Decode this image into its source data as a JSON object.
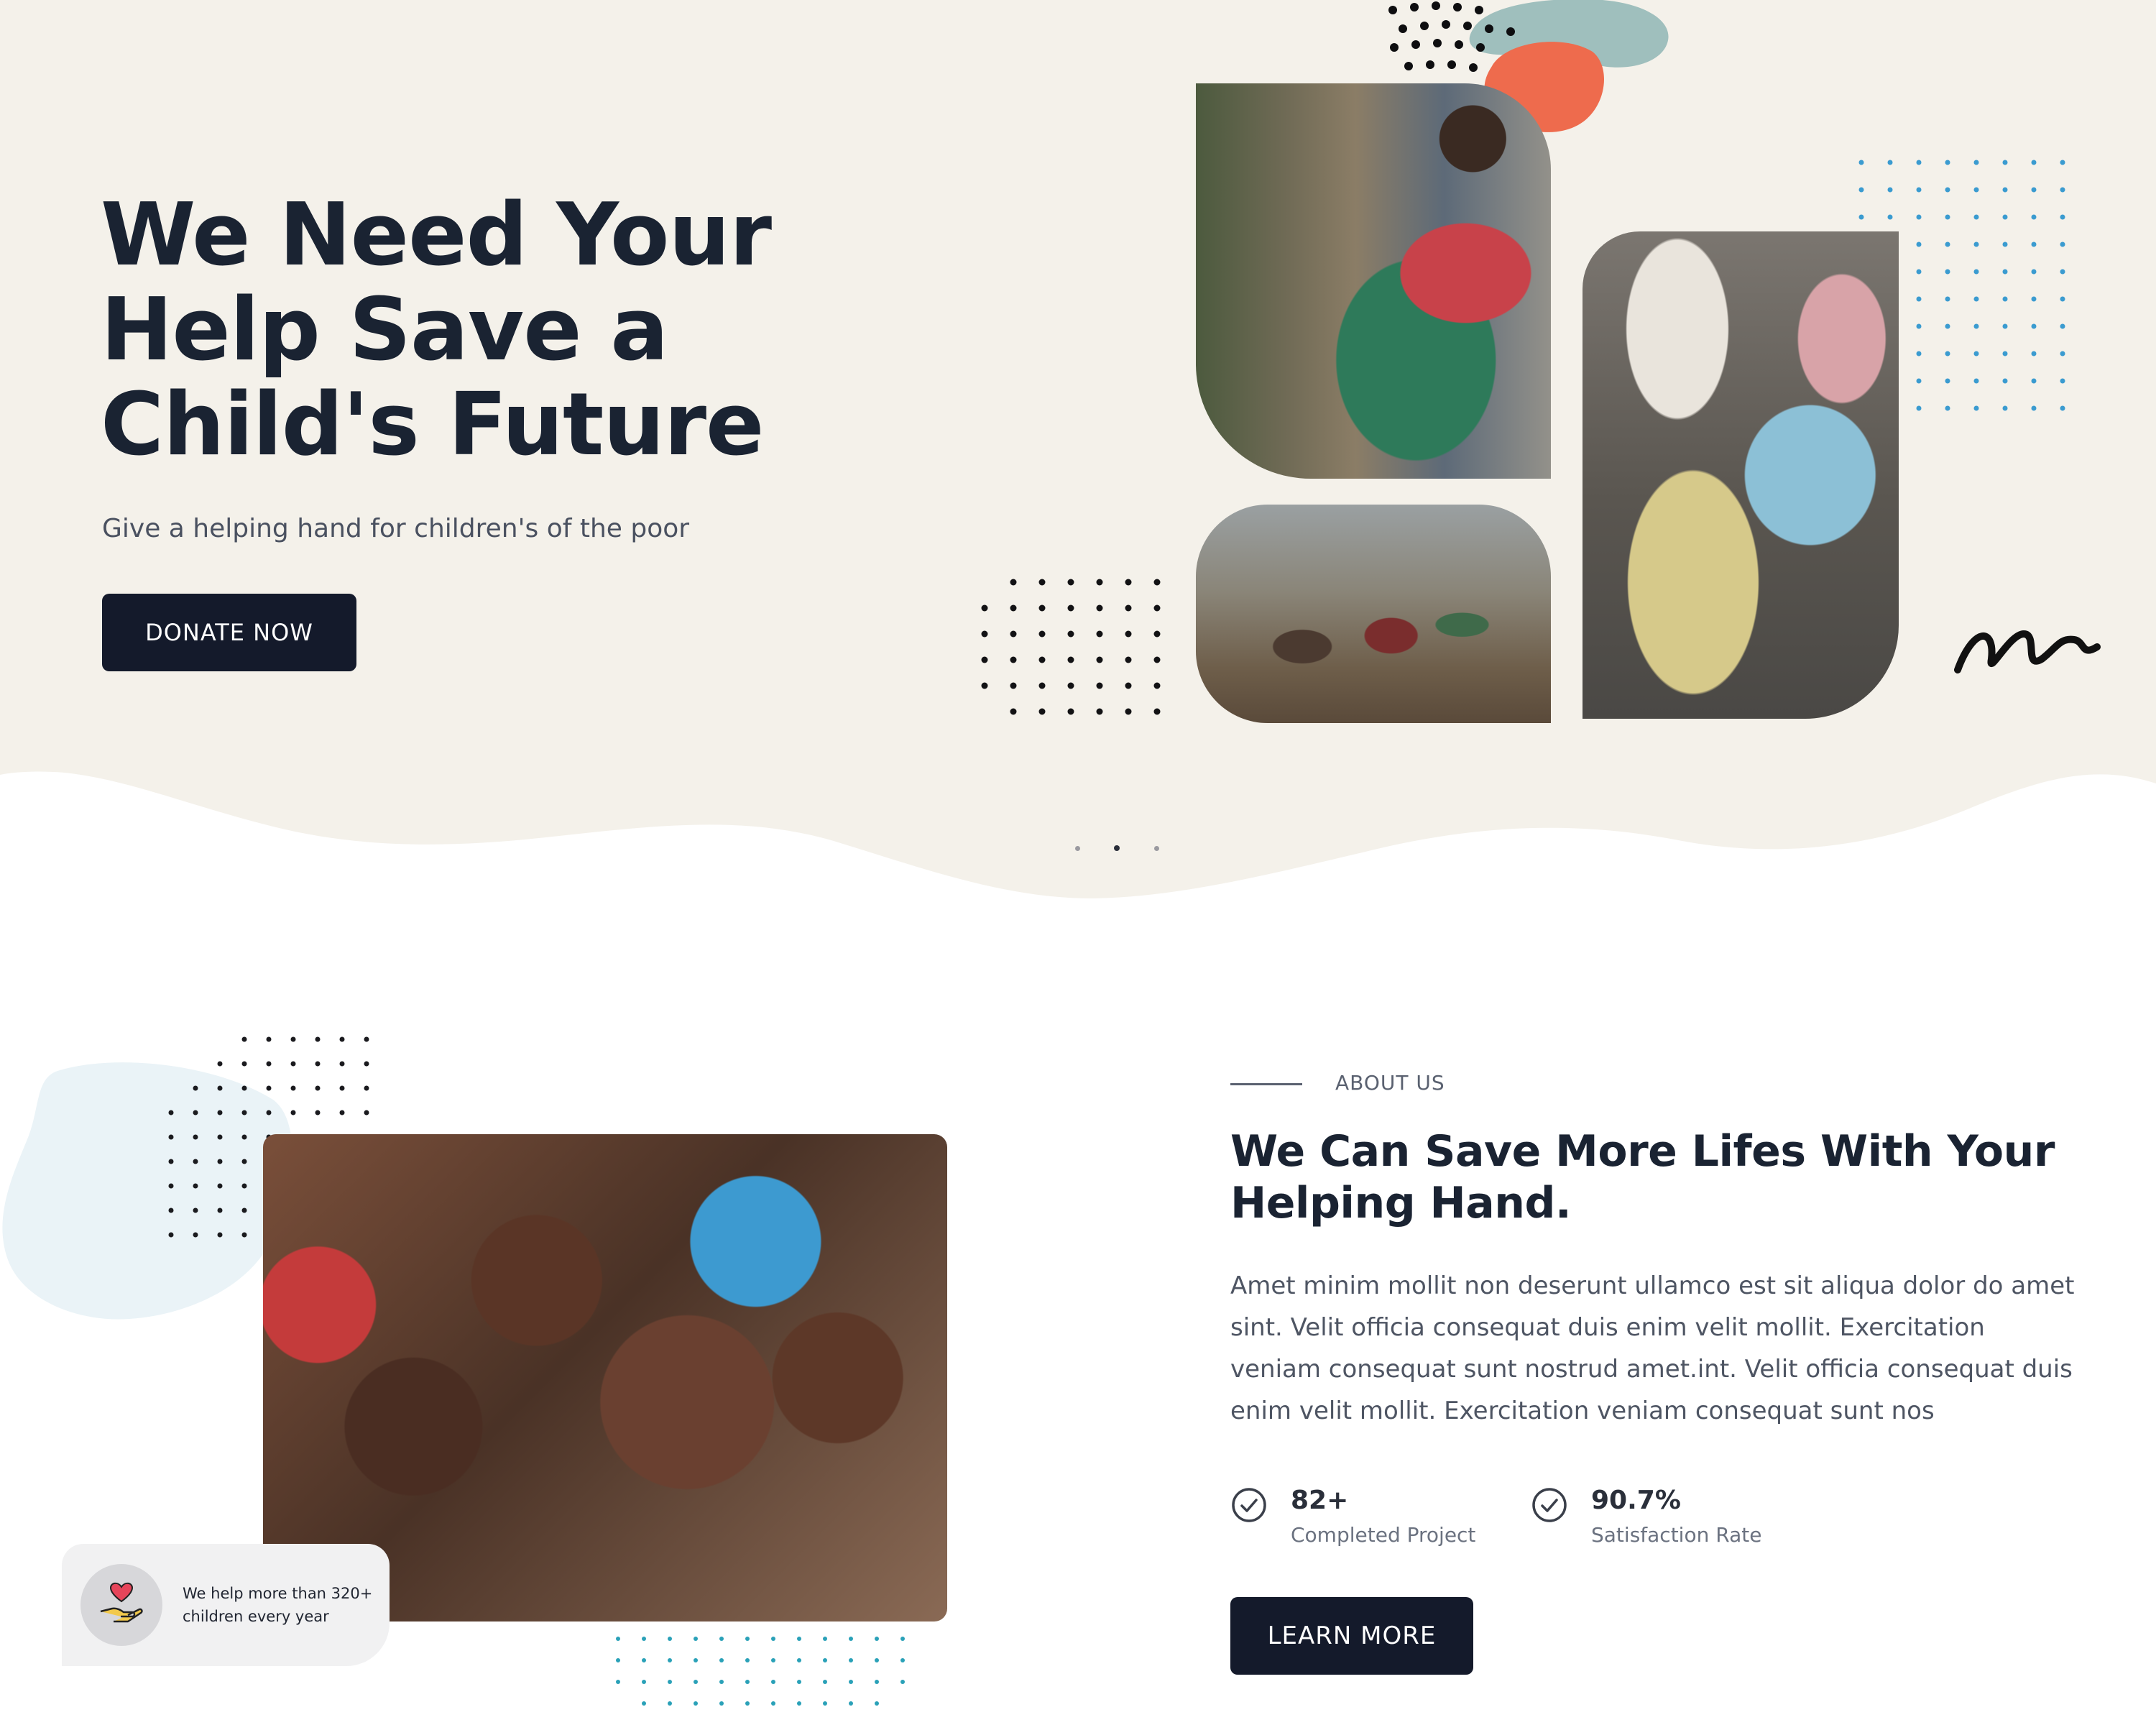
{
  "hero": {
    "title": "We Need Your Help Save a Child's Future",
    "subtitle": "Give a helping hand for children's of the poor",
    "donate_label": "DONATE NOW"
  },
  "about": {
    "section_label": "ABOUT US",
    "title": "We Can Save More Lifes With Your Helping Hand.",
    "body": "Amet minim mollit non deserunt ullamco est sit aliqua dolor do amet sint. Velit officia consequat duis enim velit mollit. Exercitation veniam consequat sunt nostrud amet.int. Velit officia consequat duis enim velit mollit. Exercitation veniam consequat sunt nos",
    "stats": [
      {
        "value": "82+",
        "label": "Completed Project",
        "icon": "check-circle-icon"
      },
      {
        "value": "90.7%",
        "label": "Satisfaction Rate",
        "icon": "check-circle-icon"
      }
    ],
    "learn_more_label": "LEARN MORE"
  },
  "badge": {
    "text": "We help more than 320+ children every year",
    "icon": "heart-hand-icon"
  },
  "slider": {
    "count": 3,
    "active_index": 1
  },
  "colors": {
    "hero_bg": "#f4f1ea",
    "dark": "#141a2b",
    "heading": "#1a2332",
    "accent_orange": "#ee6b4d",
    "accent_teal": "#9fbfbd",
    "dot_blue": "#3a9bd0",
    "pale_blue": "#eaf3f7"
  }
}
